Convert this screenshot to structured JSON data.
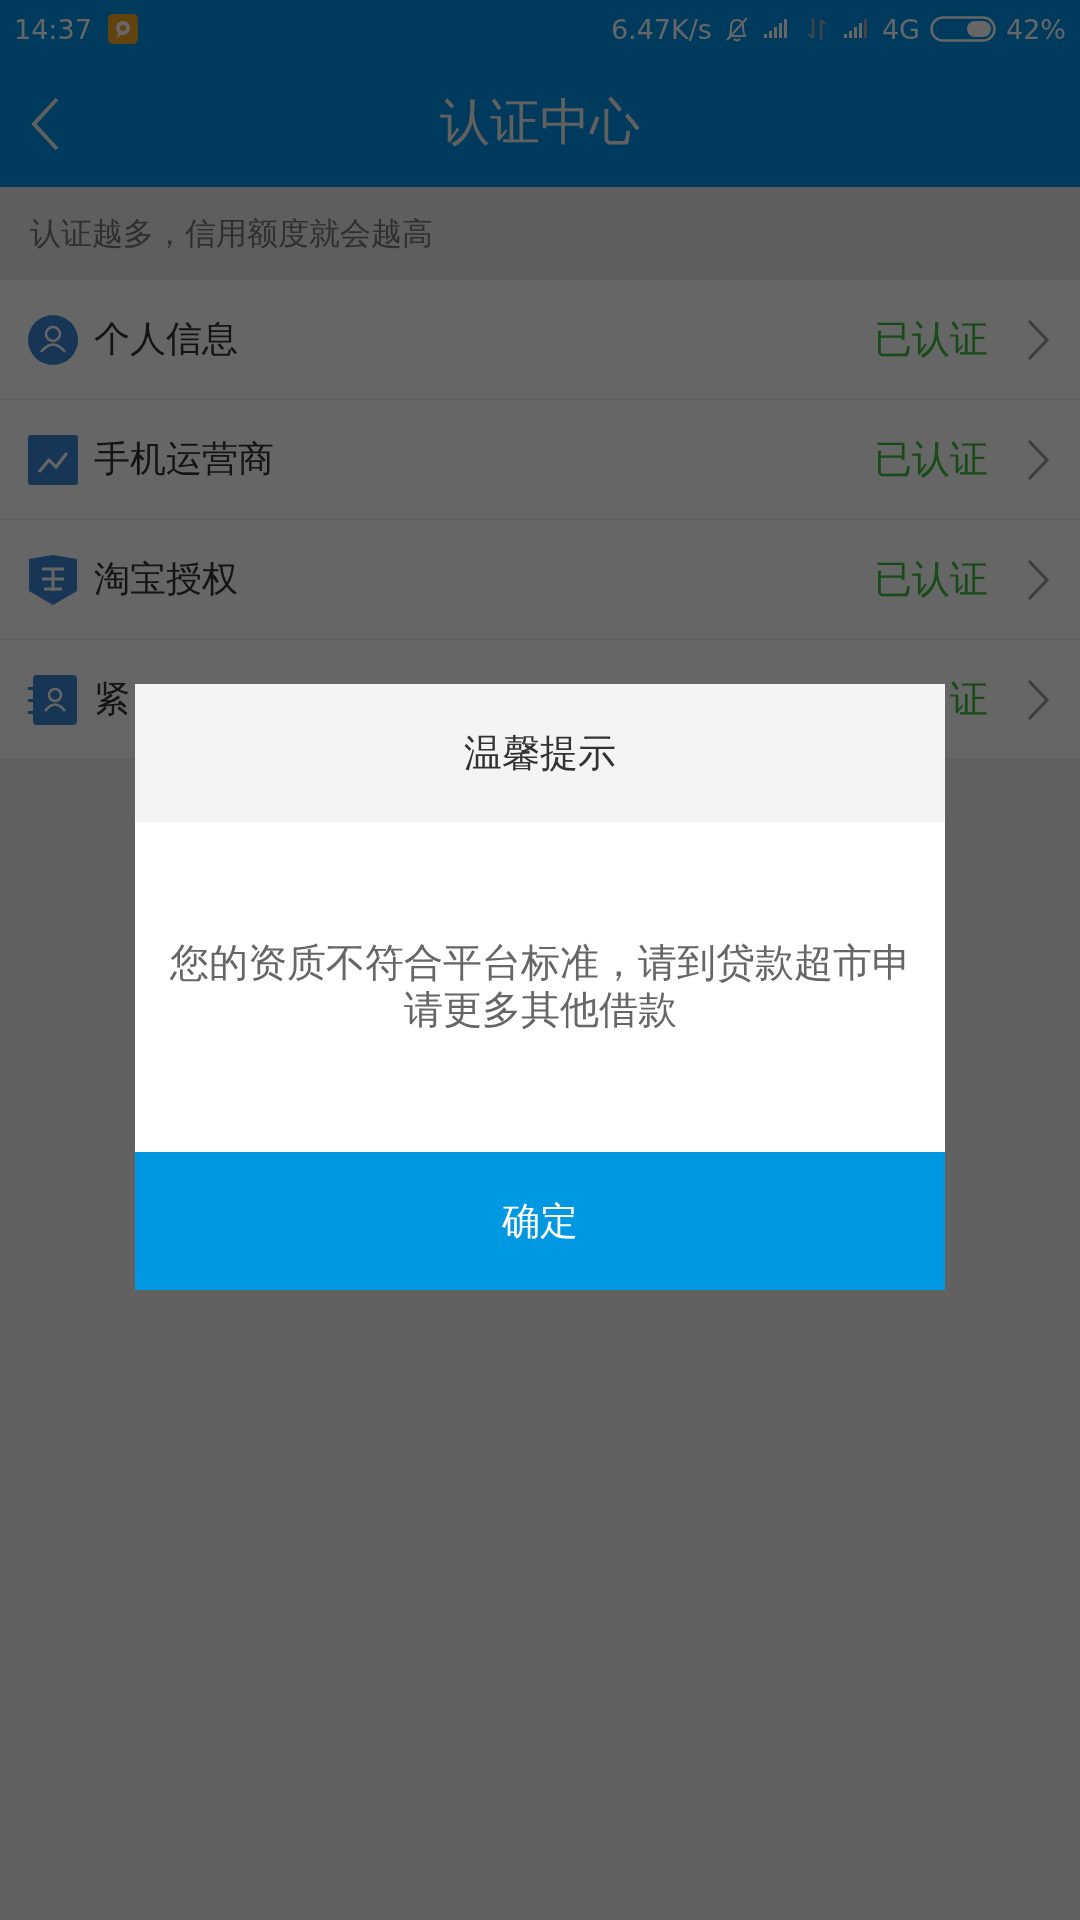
{
  "status_bar": {
    "time": "14:37",
    "speed": "6.47K/s",
    "network": "4G",
    "battery": "42%"
  },
  "header": {
    "title": "认证中心"
  },
  "hint": "认证越多，信用额度就会越高",
  "items": [
    {
      "label": "个人信息",
      "status": "已认证"
    },
    {
      "label": "手机运营商",
      "status": "已认证"
    },
    {
      "label": "淘宝授权",
      "status": "已认证"
    },
    {
      "label": "紧",
      "status": "证"
    }
  ],
  "dialog": {
    "title": "温馨提示",
    "message": "您的资质不符合平台标准，请到贷款超市申请更多其他借款",
    "button": "确定"
  }
}
